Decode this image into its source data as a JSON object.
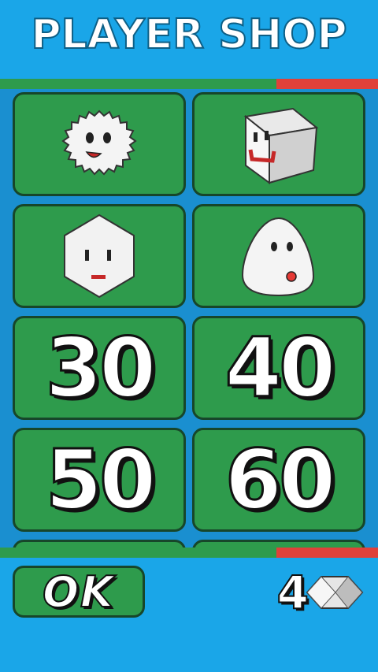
{
  "header": {
    "title": "PLAYER SHOP"
  },
  "shop_items": [
    {
      "kind": "character",
      "icon": "fluffy-ball-character-icon"
    },
    {
      "kind": "character",
      "icon": "cube-character-icon"
    },
    {
      "kind": "character",
      "icon": "hexagon-character-icon"
    },
    {
      "kind": "character",
      "icon": "egg-blob-character-icon"
    },
    {
      "kind": "price",
      "label": "30"
    },
    {
      "kind": "price",
      "label": "40"
    },
    {
      "kind": "price",
      "label": "50"
    },
    {
      "kind": "price",
      "label": "60"
    }
  ],
  "footer": {
    "ok_label": "OK",
    "currency_amount": "4",
    "currency_icon": "diamond-icon"
  },
  "colors": {
    "sky": "#1aa6e8",
    "tile_green": "#2e9b4c",
    "bar_red": "#e0413a",
    "tile_border": "#17462a"
  }
}
